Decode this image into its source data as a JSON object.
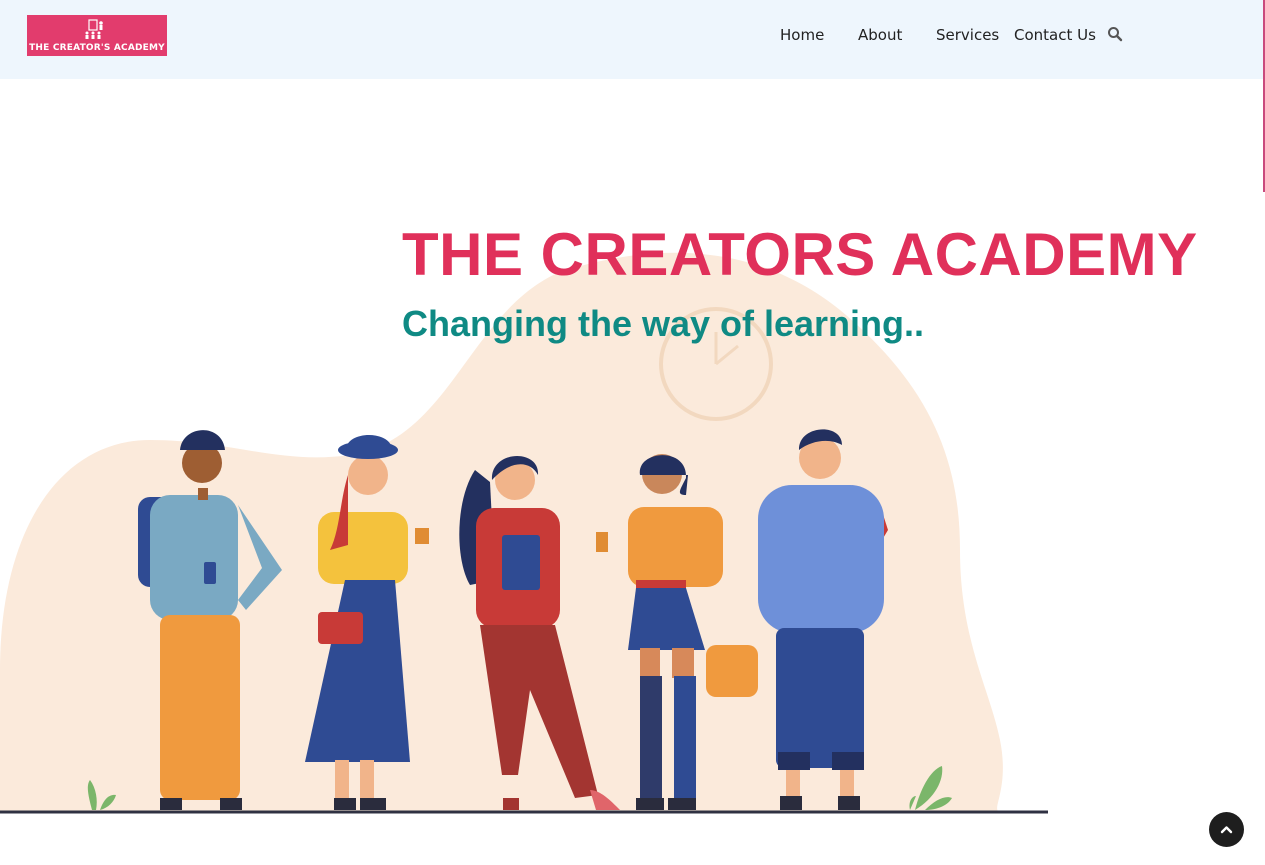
{
  "brand": {
    "logo_text": "THE CREATOR'S ACADEMY",
    "logo_color": "#e23c6d"
  },
  "nav": {
    "items": [
      {
        "label": "Home"
      },
      {
        "label": "About"
      },
      {
        "label": "Services"
      },
      {
        "label": "Contact Us"
      }
    ],
    "search_icon": "search-icon"
  },
  "hero": {
    "title": "THE CREATORS ACADEMY",
    "subtitle": "Changing the way of learning..",
    "title_color": "#e0305a",
    "subtitle_color": "#0f8a84"
  },
  "scroll_top": {
    "icon": "chevron-up-icon"
  },
  "colors": {
    "header_bg": "#eef6fd",
    "blob": "#fbeadb"
  }
}
